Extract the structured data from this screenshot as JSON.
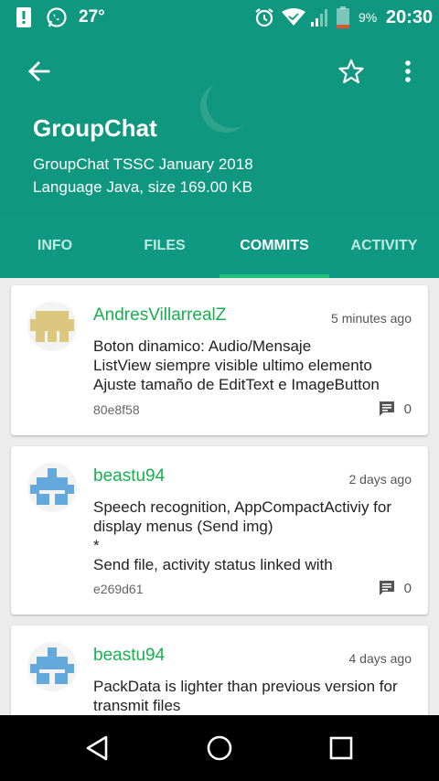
{
  "status_bar": {
    "temperature": "27°",
    "battery_percent": "9%",
    "time": "20:30",
    "icons": [
      "alert-icon",
      "whatsapp-icon",
      "alarm-icon",
      "wifi-icon",
      "signal-icon",
      "battery-icon"
    ]
  },
  "toolbar": {
    "back_icon": "arrow-back-icon",
    "star_icon": "star-outline-icon",
    "menu_icon": "more-vert-icon"
  },
  "repo": {
    "name": "GroupChat",
    "description": "GroupChat TSSC January 2018",
    "info": "Language Java, size 169.00 KB"
  },
  "tabs": [
    {
      "label": "INFO",
      "active": false
    },
    {
      "label": "FILES",
      "active": false
    },
    {
      "label": "COMMITS",
      "active": true
    },
    {
      "label": "ACTIVITY",
      "active": false
    }
  ],
  "commits": [
    {
      "author": "AndresVillarrealZ",
      "time": "5 minutes ago",
      "message": "Boton dinamico: Audio/Mensaje\nListView siempre visible ultimo elemento\nAjuste tamaño de EditText e ImageButton",
      "sha": "80e8f58",
      "comments": "0",
      "avatar_color": "#dcc77e"
    },
    {
      "author": "beastu94",
      "time": "2 days ago",
      "message": "Speech recognition, AppCompactActiviy for display menus (Send img)\n*\nSend file, activity status linked with",
      "sha": "e269d61",
      "comments": "0",
      "avatar_color": "#64a9dc"
    },
    {
      "author": "beastu94",
      "time": "4 days ago",
      "message": "PackData is lighter than previous version for transmit files",
      "sha": "",
      "comments": "",
      "avatar_color": "#64a9dc"
    }
  ],
  "nav_bar": {
    "icons": [
      "nav-back-icon",
      "nav-home-icon",
      "nav-recents-icon"
    ]
  },
  "colors": {
    "primary": "#10977f",
    "tab_indicator": "#22c27a",
    "author_green": "#16b04f"
  }
}
